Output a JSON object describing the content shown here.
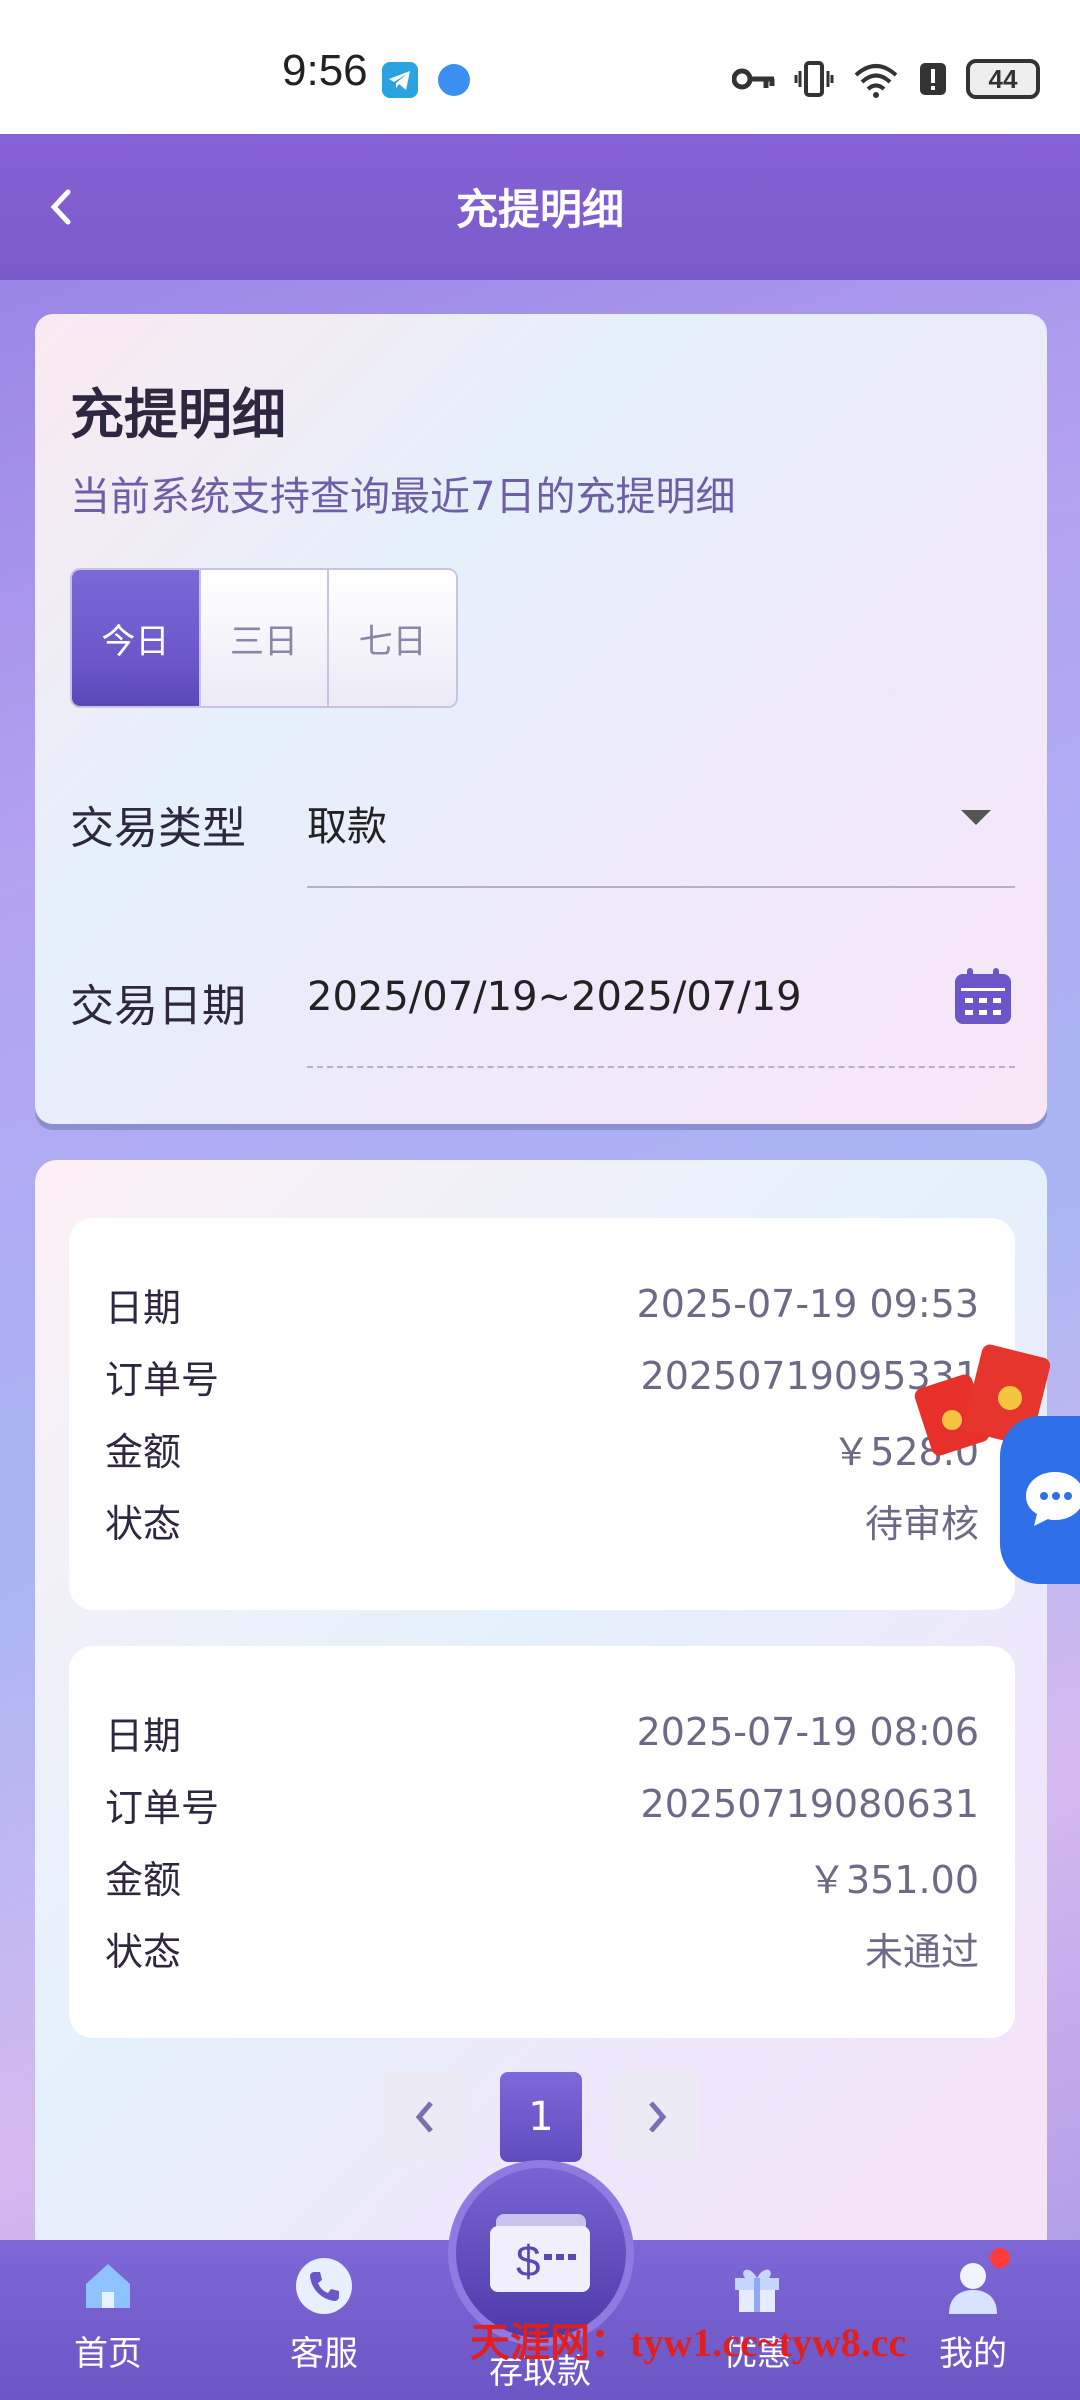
{
  "status_bar": {
    "time": "9:56",
    "battery": "44"
  },
  "header": {
    "title": "充提明细"
  },
  "filter": {
    "title": "充提明细",
    "subtitle": "当前系统支持查询最近7日的充提明细",
    "segments": [
      "今日",
      "三日",
      "七日"
    ],
    "active_segment": "今日",
    "type_label": "交易类型",
    "type_value": "取款",
    "date_label": "交易日期",
    "date_value": "2025/07/19~2025/07/19"
  },
  "records": [
    {
      "date_label": "日期",
      "date": "2025-07-19 09:53",
      "order_label": "订单号",
      "order": "20250719095331",
      "amount_label": "金额",
      "amount": "￥528.0",
      "status_label": "状态",
      "status": "待审核"
    },
    {
      "date_label": "日期",
      "date": "2025-07-19 08:06",
      "order_label": "订单号",
      "order": "20250719080631",
      "amount_label": "金额",
      "amount": "￥351.00",
      "status_label": "状态",
      "status": "未通过"
    }
  ],
  "pagination": {
    "current": "1"
  },
  "bottom_nav": {
    "home": "首页",
    "service": "客服",
    "deposit": "存取款",
    "promo": "优惠",
    "mine": "我的"
  },
  "watermark": "天涯网：tyw1.cc~tyw8.cc",
  "colors": {
    "primary": "#7a5ac9",
    "accent": "#6a56c8",
    "chat": "#2f6fe8"
  }
}
